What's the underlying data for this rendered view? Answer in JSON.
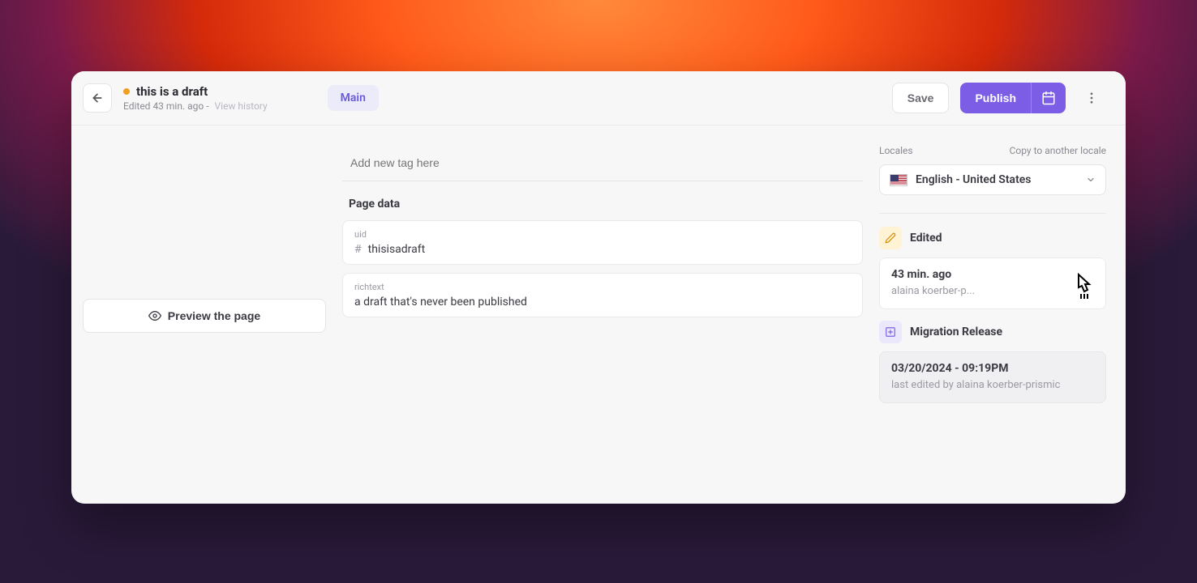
{
  "header": {
    "title": "this is a draft",
    "edited_prefix": "Edited ",
    "edited_time": "43 min. ago",
    "separator": " - ",
    "view_history": "View history",
    "tab_main": "Main",
    "save": "Save",
    "publish": "Publish"
  },
  "left": {
    "preview": "Preview the page"
  },
  "center": {
    "tag_placeholder": "Add new tag here",
    "section_title": "Page data",
    "uid": {
      "label": "uid",
      "value": "thisisadraft"
    },
    "richtext": {
      "label": "richtext",
      "value": "a draft that's never been published"
    }
  },
  "right": {
    "locales_label": "Locales",
    "copy_link": "Copy to another locale",
    "locale_value": "English - United States",
    "edited_section": "Edited",
    "edited_card": {
      "time": "43 min. ago",
      "author": "alaina koerber-p..."
    },
    "release_section": "Migration Release",
    "release_card": {
      "date": "03/20/2024 - 09:19PM",
      "detail": "last edited by alaina koerber-prismic"
    }
  }
}
